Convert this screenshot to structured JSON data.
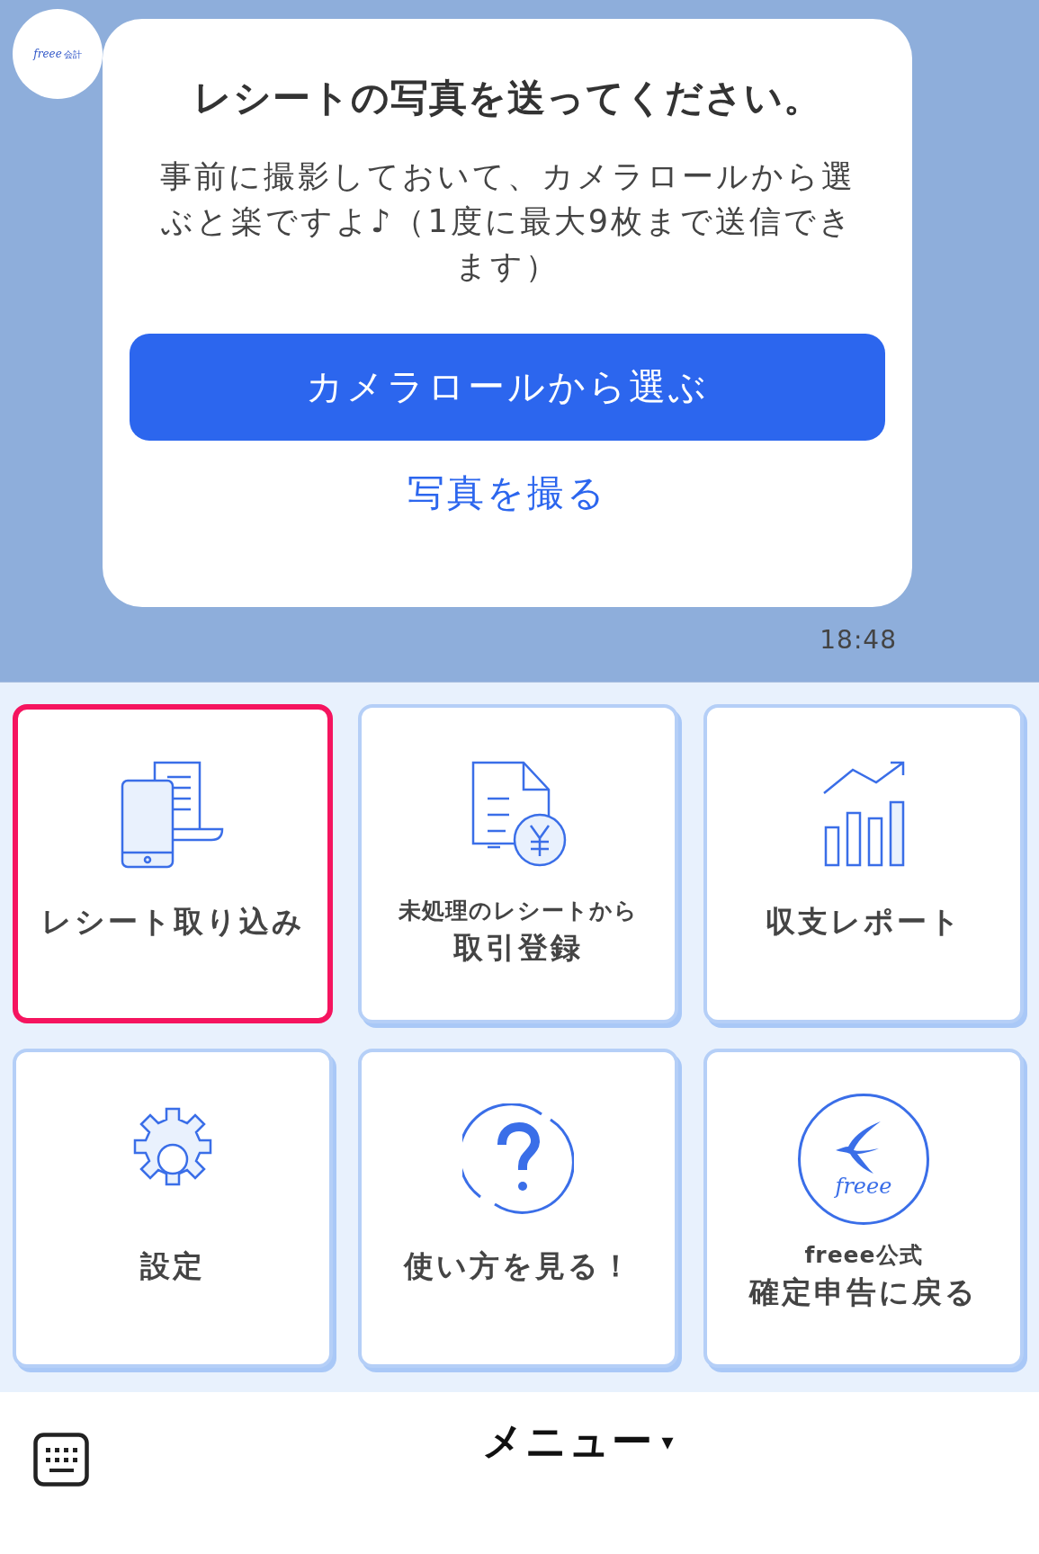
{
  "chat": {
    "avatar": {
      "logo_text": "freee",
      "logo_suffix": "会計"
    },
    "message": {
      "title": "レシートの写真を送ってください。",
      "body": "事前に撮影しておいて、カメラロールから選ぶと楽ですよ♪（1度に最大9枚まで送信できます）",
      "primary_button": "カメラロールから選ぶ",
      "link": "写真を撮る",
      "time": "18:48"
    }
  },
  "menu": {
    "tiles": [
      {
        "kind": "receipt",
        "label": "レシート取り込み",
        "selected": true
      },
      {
        "kind": "yen",
        "subtitle": "未処理のレシートから",
        "label": "取引登録",
        "selected": false
      },
      {
        "kind": "chart",
        "label": "収支レポート",
        "selected": false
      },
      {
        "kind": "gear",
        "label": "設定",
        "selected": false
      },
      {
        "kind": "help",
        "label": "使い方を見る！",
        "selected": false
      },
      {
        "kind": "logo",
        "logo_text": "freee",
        "subtitle": "freee公式",
        "label": "確定申告に戻る",
        "selected": false
      }
    ]
  },
  "bottom_bar": {
    "title": "メニュー",
    "caret": "▾"
  }
}
